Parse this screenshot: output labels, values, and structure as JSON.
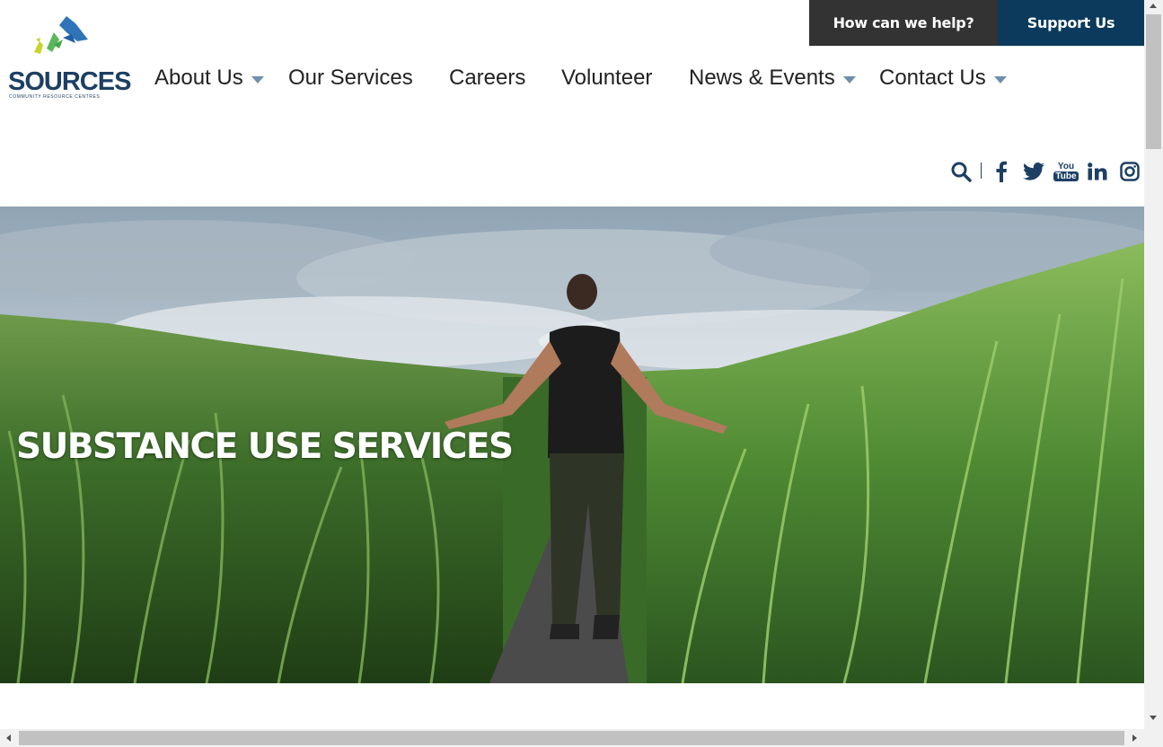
{
  "header": {
    "help_label": "How can we help?",
    "support_label": "Support Us",
    "help_bg": "#333333",
    "support_bg": "#0b3a5c"
  },
  "logo": {
    "name": "SOURCES",
    "tagline": "COMMUNITY RESOURCE CENTRES"
  },
  "nav": {
    "items": [
      {
        "label": "About Us",
        "dropdown": true
      },
      {
        "label": "Our Services",
        "dropdown": false
      },
      {
        "label": "Careers",
        "dropdown": false
      },
      {
        "label": "Volunteer",
        "dropdown": false
      },
      {
        "label": "News & Events",
        "dropdown": true
      },
      {
        "label": "Contact Us",
        "dropdown": true
      }
    ]
  },
  "social": {
    "icons": [
      "search-icon",
      "facebook-icon",
      "twitter-icon",
      "youtube-icon",
      "linkedin-icon",
      "instagram-icon"
    ],
    "youtube_text_top": "You",
    "youtube_text_bottom": "Tube",
    "icon_color": "#1d3f63"
  },
  "hero": {
    "title": "SUBSTANCE USE SERVICES"
  }
}
